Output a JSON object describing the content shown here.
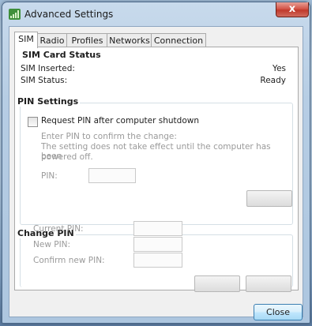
{
  "window": {
    "title": "Advanced Settings",
    "close_glyph": "x",
    "close_button_label": "Close"
  },
  "tabs": [
    {
      "label": "SIM",
      "active": true
    },
    {
      "label": "Radio",
      "active": false
    },
    {
      "label": "Profiles",
      "active": false
    },
    {
      "label": "Networks",
      "active": false
    },
    {
      "label": "Connection",
      "active": false
    }
  ],
  "sim_card_status": {
    "heading": "SIM Card Status",
    "inserted_label": "SIM Inserted:",
    "inserted_value": "Yes",
    "status_label": "SIM Status:",
    "status_value": "Ready"
  },
  "pin_settings": {
    "heading": "PIN Settings",
    "checkbox_label": "Request PIN after computer shutdown",
    "checkbox_checked": false,
    "info_line1": "Enter PIN to confirm the change:",
    "info_line2": "The setting does not take effect until the computer has been",
    "info_line3": "powered off.",
    "pin_label": "PIN:",
    "pin_value": ""
  },
  "change_pin": {
    "heading": "Change PIN",
    "current_label": "Current PIN:",
    "new_label": "New PIN:",
    "confirm_label": "Confirm new PIN:",
    "current_value": "",
    "new_value": "",
    "confirm_value": ""
  },
  "icons": {
    "app": "signal-bars-icon",
    "close": "close-icon"
  },
  "colors": {
    "close_red": "#c0392b",
    "default_button_border": "#3c7fb1"
  }
}
